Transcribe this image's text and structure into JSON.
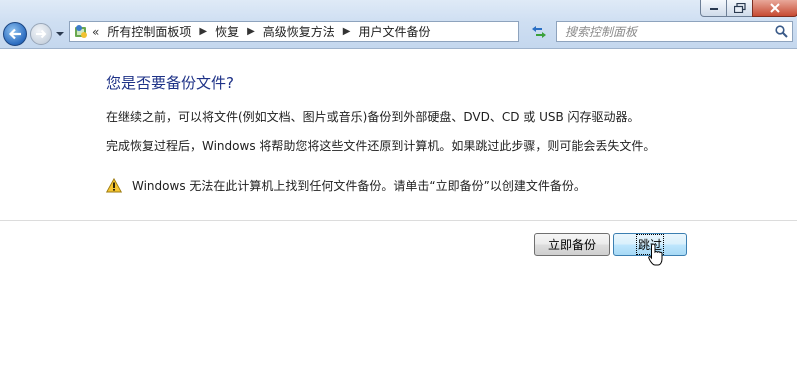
{
  "window": {
    "controls": [
      "minimize-icon",
      "maximize-icon",
      "close-icon"
    ]
  },
  "navigation": {
    "back_icon": "back-arrow-icon",
    "forward_icon": "forward-arrow-icon"
  },
  "address_bar": {
    "overflow": "«",
    "breadcrumbs": [
      "所有控制面板项",
      "恢复",
      "高级恢复方法",
      "用户文件备份"
    ],
    "separator": "▶"
  },
  "search": {
    "placeholder": "搜索控制面板"
  },
  "content": {
    "title": "您是否要备份文件?",
    "paragraph1": "在继续之前，可以将文件(例如文档、图片或音乐)备份到外部硬盘、DVD、CD 或 USB 闪存驱动器。",
    "paragraph2": "完成恢复过程后，Windows 将帮助您将这些文件还原到计算机。如果跳过此步骤，则可能会丢失文件。",
    "warning": "Windows 无法在此计算机上找到任何文件备份。请单击“立即备份”以创建文件备份。"
  },
  "buttons": {
    "backup_now": "立即备份",
    "skip": "跳过"
  },
  "colors": {
    "title": "#1e3287",
    "accent": "#3c7fb1"
  }
}
